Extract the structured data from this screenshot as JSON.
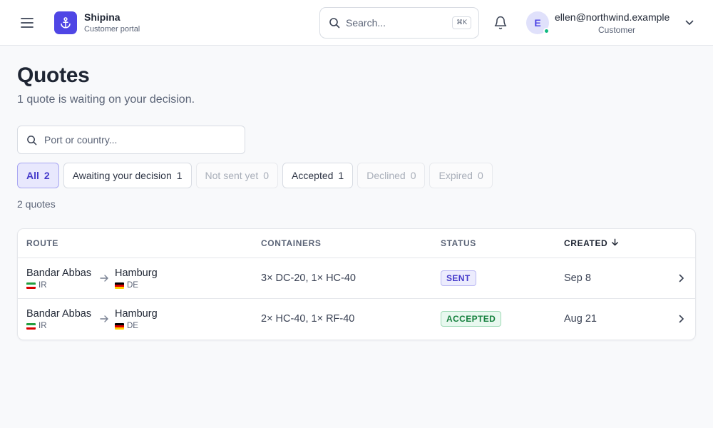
{
  "colors": {
    "brand": "#4f46e5",
    "active_chip_bg": "#e8e8fd",
    "sent_badge": "#4338ca",
    "accepted_badge": "#15803d",
    "online": "#10b981"
  },
  "header": {
    "menu_icon": "hamburger-menu-icon",
    "brand_icon": "anchor-icon",
    "brand_name": "Shipina",
    "brand_subtitle": "Customer portal",
    "search": {
      "placeholder": "Search...",
      "shortcut": "⌘K",
      "icon": "search-icon"
    },
    "notifications_icon": "bell-icon",
    "user": {
      "initial": "E",
      "email": "ellen@northwind.example",
      "role": "Customer",
      "status": "online",
      "menu_icon": "chevron-down-icon"
    }
  },
  "page": {
    "title": "Quotes",
    "subtitle": "1 quote is waiting on your decision."
  },
  "filter": {
    "placeholder": "Port or country...",
    "value": "",
    "icon": "search-icon"
  },
  "chips": [
    {
      "label": "All",
      "count": "2",
      "state": "active"
    },
    {
      "label": "Awaiting your decision",
      "count": "1",
      "state": "enabled"
    },
    {
      "label": "Not sent yet",
      "count": "0",
      "state": "disabled"
    },
    {
      "label": "Accepted",
      "count": "1",
      "state": "enabled"
    },
    {
      "label": "Declined",
      "count": "0",
      "state": "disabled"
    },
    {
      "label": "Expired",
      "count": "0",
      "state": "disabled"
    }
  ],
  "result_count": "2 quotes",
  "table": {
    "columns": {
      "route": "ROUTE",
      "containers": "CONTAINERS",
      "status": "STATUS",
      "created": "CREATED"
    },
    "sort": {
      "column": "created",
      "direction": "descending",
      "icon": "arrow-down-icon"
    },
    "rows": [
      {
        "origin": {
          "port": "Bandar Abbas",
          "country": "IR",
          "flag": "flag-iran"
        },
        "destination": {
          "port": "Hamburg",
          "country": "DE",
          "flag": "flag-germany"
        },
        "containers": "3× DC-20, 1× HC-40",
        "status": "SENT",
        "created": "Sep 8"
      },
      {
        "origin": {
          "port": "Bandar Abbas",
          "country": "IR",
          "flag": "flag-iran"
        },
        "destination": {
          "port": "Hamburg",
          "country": "DE",
          "flag": "flag-germany"
        },
        "containers": "2× HC-40, 1× RF-40",
        "status": "ACCEPTED",
        "created": "Aug 21"
      }
    ]
  }
}
